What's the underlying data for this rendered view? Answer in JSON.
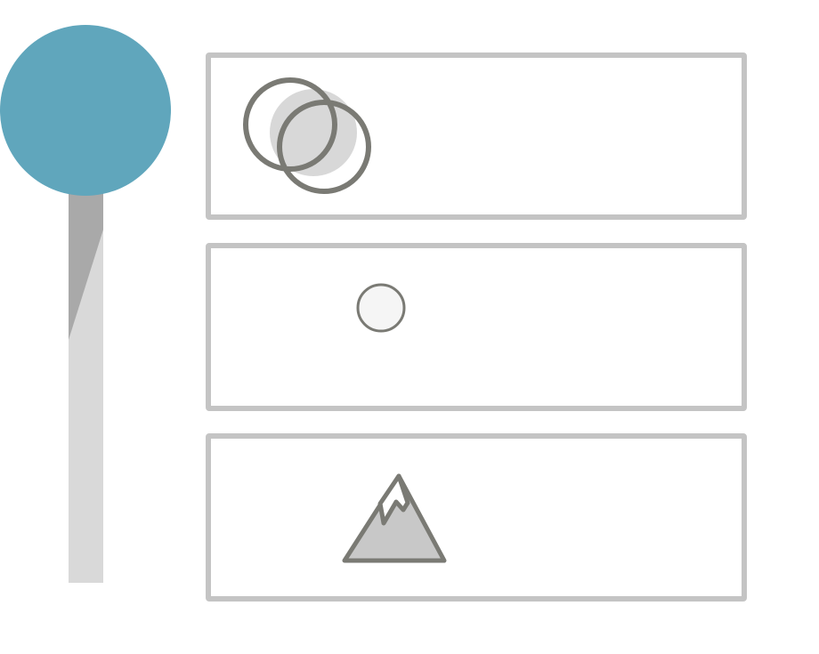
{
  "colors": {
    "knob": "#60a6bc",
    "track_light": "#d9d9d9",
    "track_dark": "#a9a9a9",
    "card_border": "#c4c4c4",
    "icon_stroke": "#7a7a74",
    "icon_fill": "#d8d8d8",
    "dot_fill": "#f5f5f5",
    "mountain_fill": "#c8c8c8"
  },
  "icons": {
    "card_1": "overlapping-circles-icon",
    "card_2": "small-circle-icon",
    "card_3": "mountain-icon"
  },
  "timeline": {
    "fill_fraction": 0.25
  }
}
